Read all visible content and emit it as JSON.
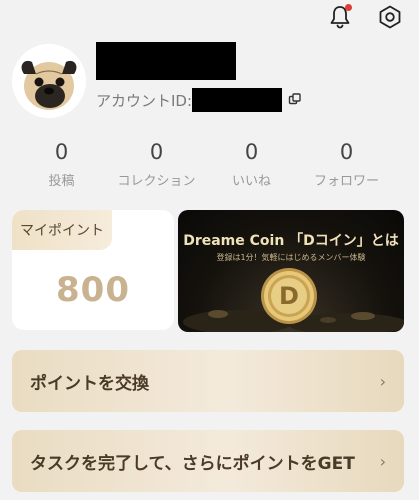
{
  "header": {
    "notification_icon": "bell-icon",
    "settings_icon": "hexagon-gear-icon",
    "accent": "#e03b3b"
  },
  "profile": {
    "account_id_label": "アカウントID:",
    "copy_icon": "copy-icon"
  },
  "stats": [
    {
      "value": "0",
      "label": "投稿"
    },
    {
      "value": "0",
      "label": "コレクション"
    },
    {
      "value": "0",
      "label": "いいね"
    },
    {
      "value": "0",
      "label": "フォロワー"
    }
  ],
  "points": {
    "tab_label": "マイポイント",
    "value": "800"
  },
  "banner": {
    "title": "Dreame Coin 「Dコイン」とは",
    "subtitle": "登録は1分！気軽にはじめるメンバー体験",
    "coin_letter": "D"
  },
  "actions": [
    {
      "label": "ポイントを交換",
      "chevron": "›"
    },
    {
      "label": "タスクを完了して、さらにポイントをGET",
      "chevron": "›"
    }
  ]
}
